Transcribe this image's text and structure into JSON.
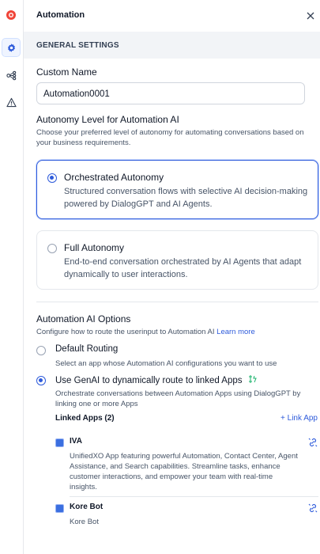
{
  "sidebar": {
    "items": [
      {
        "icon": "app-logo-icon"
      },
      {
        "icon": "gear-icon"
      },
      {
        "icon": "flow-icon"
      },
      {
        "icon": "warning-icon"
      }
    ]
  },
  "header": {
    "title": "Automation"
  },
  "section": {
    "title": "GENERAL SETTINGS"
  },
  "custom_name": {
    "label": "Custom Name",
    "value": "Automation0001"
  },
  "autonomy": {
    "label": "Autonomy Level for Automation AI",
    "description": "Choose your preferred level of autonomy for automating conversations based on your business requirements.",
    "options": [
      {
        "title": "Orchestrated Autonomy",
        "description": "Structured conversation flows with selective AI decision-making powered by DialogGPT and AI Agents.",
        "selected": true
      },
      {
        "title": "Full Autonomy",
        "description": "End-to-end conversation orchestrated by AI Agents that adapt dynamically to user interactions.",
        "selected": false
      }
    ]
  },
  "ai_options": {
    "label": "Automation AI Options",
    "description": "Configure how to route the userinput to Automation AI",
    "learn_more": "Learn more",
    "default_routing": {
      "title": "Default Routing",
      "description": "Select an app whose Automation AI configurations you want to use",
      "selected": false
    },
    "genai_routing": {
      "title": "Use GenAI to dynamically route to linked Apps",
      "description": "Orchestrate conversations between Automation Apps using DialogGPT by linking one or more Apps",
      "selected": true
    },
    "linked_apps_label": "Linked Apps (2)",
    "link_app_label": "+ Link App",
    "apps": [
      {
        "name": "IVA",
        "description": "UnifiedXO App featuring powerful Automation, Contact Center, Agent Assistance, and Search capabilities. Streamline tasks, enhance customer interactions, and empower your team with real-time insights."
      },
      {
        "name": "Kore Bot",
        "description": "Kore Bot"
      }
    ]
  },
  "colors": {
    "accent": "#2e5bdb",
    "band": "#f2f4f7",
    "border": "#e4e7ec"
  }
}
